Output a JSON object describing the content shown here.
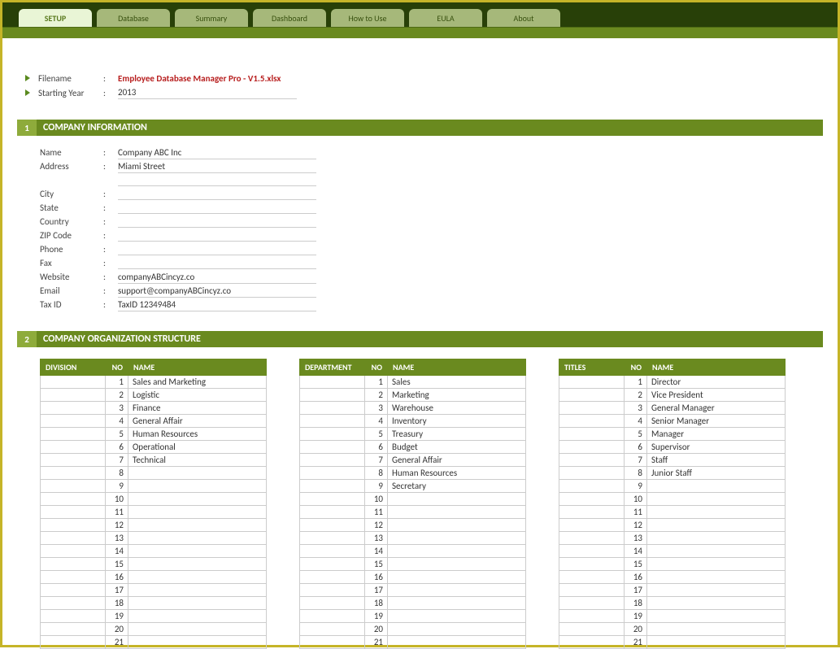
{
  "tabs": {
    "active": "SETUP",
    "inactive": [
      "Database",
      "Summary",
      "Dashboard",
      "How to Use",
      "EULA",
      "About"
    ]
  },
  "meta": {
    "filename_label": "Filename",
    "filename_value": "Employee Database Manager Pro - V1.5.xlsx",
    "year_label": "Starting Year",
    "year_value": "2013"
  },
  "section1": {
    "num": "1",
    "title": "COMPANY INFORMATION",
    "rows": [
      {
        "label": "Name",
        "value": "Company ABC Inc"
      },
      {
        "label": "Address",
        "value": "Miami Street"
      },
      {
        "label": "",
        "value": ""
      },
      {
        "label": "City",
        "value": ""
      },
      {
        "label": "State",
        "value": ""
      },
      {
        "label": "Country",
        "value": ""
      },
      {
        "label": "ZIP Code",
        "value": ""
      },
      {
        "label": "Phone",
        "value": ""
      },
      {
        "label": "Fax",
        "value": ""
      },
      {
        "label": "Website",
        "value": "companyABCincyz.co"
      },
      {
        "label": "Email",
        "value": "support@companyABCincyz.co"
      },
      {
        "label": "Tax ID",
        "value": "TaxID 12349484"
      }
    ]
  },
  "section2": {
    "num": "2",
    "title": "COMPANY ORGANIZATION STRUCTURE",
    "headers": {
      "no": "NO",
      "name": "NAME"
    },
    "tables": [
      {
        "head": "DIVISION",
        "rows": [
          "Sales and Marketing",
          "Logistic",
          "Finance",
          "General Affair",
          "Human Resources",
          "Operational",
          "Technical"
        ]
      },
      {
        "head": "DEPARTMENT",
        "rows": [
          "Sales",
          "Marketing",
          "Warehouse",
          "Inventory",
          "Treasury",
          "Budget",
          "General Affair",
          "Human Resources",
          "Secretary"
        ]
      },
      {
        "head": "TITLES",
        "rows": [
          "Director",
          "Vice President",
          "General Manager",
          "Senior Manager",
          "Manager",
          "Supervisor",
          "Staff",
          "Junior Staff"
        ]
      }
    ],
    "total_rows": 21
  }
}
